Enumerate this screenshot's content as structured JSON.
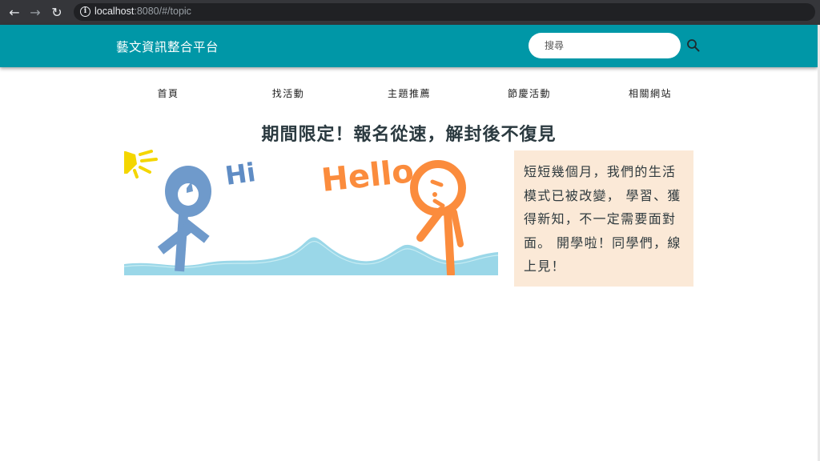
{
  "browser": {
    "url_host": "localhost",
    "url_rest": ":8080/#/topic",
    "back_icon": "arrow-left",
    "forward_icon": "arrow-right",
    "reload_icon": "reload"
  },
  "header": {
    "site_title": "藝文資訊整合平台",
    "search_placeholder": "搜尋",
    "bg_color": "#0097a7"
  },
  "nav": {
    "items": [
      {
        "label": "首頁"
      },
      {
        "label": "找活動"
      },
      {
        "label": "主題推薦"
      },
      {
        "label": "節慶活動"
      },
      {
        "label": "相關網站"
      }
    ]
  },
  "main": {
    "headline": "期間限定！報名從速，解封後不復見",
    "banner": {
      "hi_text": "Hi",
      "hello_text": "Hello"
    },
    "side_text": "短短幾個月，我們的生活模式已被改變， 學習、獲得新知，不一定需要面對面。 開學啦！同學們，線上見！",
    "side_bg": "#fbe9d7"
  }
}
